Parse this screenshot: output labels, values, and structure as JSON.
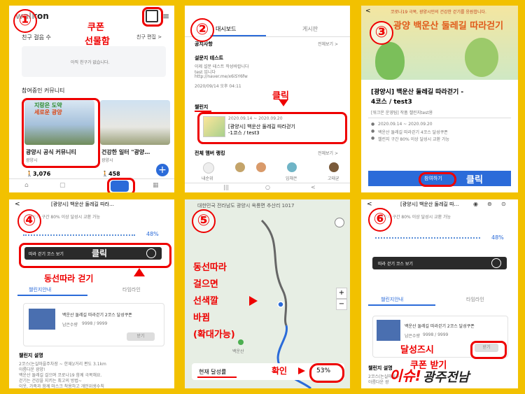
{
  "p1": {
    "logo": "walkon",
    "coupon_label_1": "쿠폰",
    "coupon_label_2": "선물함",
    "friend_count": "친구 걸음 수",
    "friend_edit": "친구 편집 >",
    "no_friend": "아직 친구가 없습니다.",
    "community_title": "참여중인 커뮤니티",
    "card1_title": "광양시 공식 커뮤니티",
    "card1_sub": "광양시",
    "card1_count": "3,076",
    "card2_title": "건강한 일터 \"광양…",
    "card2_sub": "광양시",
    "card2_count": "458",
    "card1_img_text_1": "지랑은 도약",
    "card1_img_text_2": "세로운 광양"
  },
  "p2": {
    "tab_dashboard": "대시보드",
    "tab_board": "게시판",
    "notice_title": "공지사항",
    "view_all": "전체보기 >",
    "notice_item": "설문지 테스트",
    "notice_body_1": "이제 설문 테스트 작성바랍니다",
    "notice_body_2": "test 입니다",
    "notice_body_3": "http://naver.me/x6iSY6fw",
    "notice_date": "2020/09/14 오후 04:11",
    "click_label": "클릭",
    "challenge_title": "챌린지",
    "challenge_date": "2020.09.14 ~ 2020.09.20",
    "challenge_name_1": "[광양시] 백운산 둘레길 따라걷기",
    "challenge_name_2": "-1코스 / test3",
    "rank_title": "전체 멤버 랭킹",
    "rank_view_all": "전체보기 >",
    "rank_names": [
      "내순위",
      "?",
      "?",
      "임채은",
      "고태균"
    ]
  },
  "p3": {
    "banner_small": "코로나19 극복, 광양시민의 건강한 걷기를 응원합니다.",
    "banner_title": "광양 백운산 둘레길 따라걷기",
    "title_1": "[광양시] 백운산 둘레길 따라걷기 -",
    "title_2": "4코스 / test3",
    "host": "[워크온 운영팀] 작품 챌린지test용",
    "date": "2020.09.14 ~ 2020.09.20",
    "reward": "백운산 둘레길 따라걷기 4코스 달성쿠폰",
    "condition": "챌린지 구간 80% 이상 달성시 교환 가능",
    "join_btn": "참여하기",
    "click_label": "클릭"
  },
  "p4": {
    "title": "[광양시] 백운산 둘레길 따라…",
    "condition": "챌린지 구간 80% 이상 달성시 교환 가능",
    "percent": "48%",
    "progress": 0.48,
    "course_btn": "따라 걷기 코스 보기",
    "click_label": "클릭",
    "follow_label": "동선따라 걷기",
    "tab_info": "챌린지안내",
    "tab_timeline": "타임라인",
    "coupon_name": "백운산 둘레길 따라걷기 2코스 달성쿠폰",
    "coupon_left": "남은수량",
    "coupon_count": "9998 / 9999",
    "coupon_btn": "받기",
    "desc_title": "챌린지 설명",
    "desc_1": "2코스(논실마을주차장 ~ 한재)/거리 편도 3.1km",
    "desc_2": "아름다운 광양!",
    "desc_3": "백운산 둘레길 걸으며 코로나19 함께 극복해요.",
    "desc_4": "걷기는 건강을 지키는 최고의 방법~",
    "desc_5": "이웃, 가족과 함께 마스크 착용하고 개인위생수칙"
  },
  "p5": {
    "address": "대한민국 전라남도 광양시 옥룡면 추산리 1017",
    "text_1": "동선따라",
    "text_2": "걸으면",
    "text_3": "선색깔",
    "text_4": "바뀜",
    "text_5": "(확대가능)",
    "place": "백운산",
    "current_label": "현재 달성률",
    "confirm": "확인",
    "percent": "53%",
    "zoom_in": "+",
    "zoom_out": "−"
  },
  "p6": {
    "title": "[광양시] 백운산 둘레길 따…",
    "condition": "챌린지 구간 80% 이상 달성시 교환 가능",
    "percent": "48%",
    "progress": 0.48,
    "course_btn": "따라 걷기 코스 보기",
    "tab_info": "챌린지안내",
    "tab_timeline": "타임라인",
    "coupon_name": "백운산 둘레길 따라걷기 2코스 달성쿠폰",
    "coupon_left": "남은수량",
    "coupon_count": "9998 / 9999",
    "coupon_btn": "받기",
    "desc_title": "챌린지 설명",
    "desc_1": "2코스(논실마을주",
    "desc_2": "아름다운 광",
    "overlay_1": "달성즈시",
    "overlay_2": "쿠폰 받기",
    "watermark_1": "이슈!",
    "watermark_2": "광주전남"
  },
  "numbers": [
    "①",
    "②",
    "③",
    "④",
    "⑤",
    "⑥"
  ]
}
